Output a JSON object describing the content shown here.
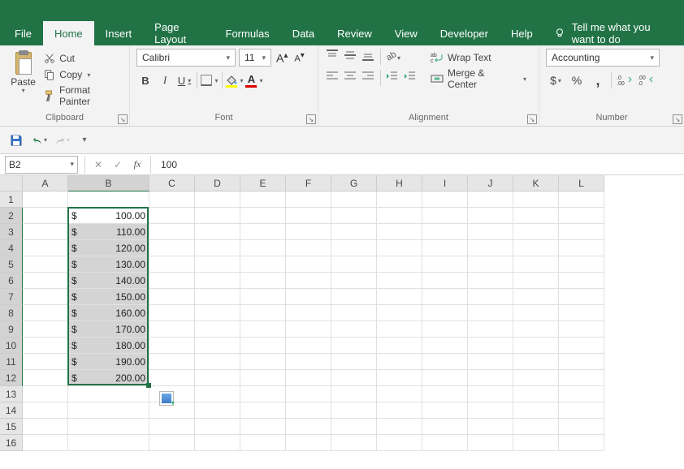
{
  "tabs": {
    "file": "File",
    "home": "Home",
    "insert": "Insert",
    "page_layout": "Page Layout",
    "formulas": "Formulas",
    "data": "Data",
    "review": "Review",
    "view": "View",
    "developer": "Developer",
    "help": "Help",
    "tell_me": "Tell me what you want to do"
  },
  "clipboard": {
    "paste": "Paste",
    "cut": "Cut",
    "copy": "Copy",
    "format_painter": "Format Painter",
    "label": "Clipboard"
  },
  "font": {
    "name": "Calibri",
    "size": "11",
    "bold": "B",
    "italic": "I",
    "underline": "U",
    "label": "Font"
  },
  "alignment": {
    "wrap": "Wrap Text",
    "merge": "Merge & Center",
    "label": "Alignment"
  },
  "number": {
    "format": "Accounting",
    "currency": "$",
    "percent": "%",
    "comma": ",",
    "label": "Number"
  },
  "name_box": "B2",
  "formula_fx": "fx",
  "formula_value": "100",
  "columns": [
    "A",
    "B",
    "C",
    "D",
    "E",
    "F",
    "G",
    "H",
    "I",
    "J",
    "K",
    "L"
  ],
  "row_count": 16,
  "selected_col": "B",
  "active_row": 2,
  "sel_start_row": 2,
  "sel_end_row": 12,
  "currency_symbol": "$",
  "cells_b": {
    "2": "100.00",
    "3": "110.00",
    "4": "120.00",
    "5": "130.00",
    "6": "140.00",
    "7": "150.00",
    "8": "160.00",
    "9": "170.00",
    "10": "180.00",
    "11": "190.00",
    "12": "200.00"
  }
}
